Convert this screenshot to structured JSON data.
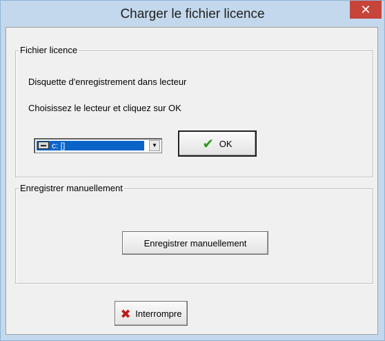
{
  "window": {
    "title": "Charger le fichier licence",
    "close_glyph": "✕"
  },
  "license_group": {
    "legend": "Fichier licence",
    "line1": "Disquette d'enregistrement dans lecteur",
    "line2": "Choisissez le lecteur et cliquez sur OK",
    "drive_select": {
      "value": "c: []",
      "icon": "drive-icon",
      "arrow_glyph": "▼"
    },
    "ok_button": {
      "label": "OK",
      "icon_glyph": "✔"
    }
  },
  "manual_group": {
    "legend": "Enregistrer manuellement",
    "button_label": "Enregistrer manuellement"
  },
  "interrupt_button": {
    "label": "Interrompre",
    "icon_glyph": "✖"
  },
  "colors": {
    "title_bar": "#c3d8ec",
    "close_button": "#c7443b",
    "selection": "#0a64c8"
  }
}
